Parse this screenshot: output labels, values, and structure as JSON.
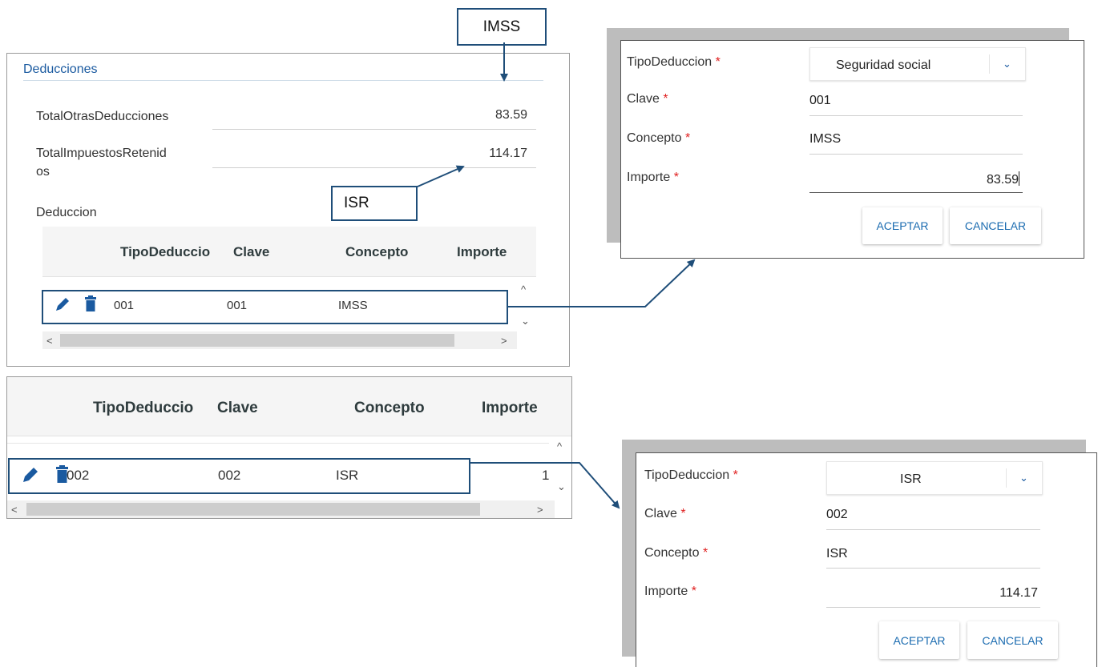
{
  "callouts": {
    "imss": "IMSS",
    "isr": "ISR"
  },
  "deducciones": {
    "title": "Deducciones",
    "total_otras_label": "TotalOtrasDeducciones",
    "total_otras_value": "83.59",
    "total_impuestos_label_line1": "TotalImpuestosRetenid",
    "total_impuestos_label_line2": "os",
    "total_impuestos_value": "114.17",
    "deduccion_label": "Deduccion"
  },
  "table_columns": [
    "TipoDeduccio",
    "Clave",
    "Concepto",
    "Importe"
  ],
  "table_top": {
    "row": {
      "tipo": "001",
      "clave": "001",
      "concepto": "IMSS"
    }
  },
  "table_bottom": {
    "row": {
      "tipo": "002",
      "clave": "002",
      "concepto": "ISR",
      "importe_partial": "1"
    }
  },
  "scroll_glyphs": {
    "up": "^",
    "down": "⌄",
    "left": "<",
    "right": ">"
  },
  "form_labels": {
    "tipo": "TipoDeduccion",
    "clave": "Clave",
    "concepto": "Concepto",
    "importe": "Importe",
    "required": "*"
  },
  "dialog_imss": {
    "tipo_value": "Seguridad social",
    "clave_value": "001",
    "concepto_value": "IMSS",
    "importe_value": "83.59",
    "accept": "ACEPTAR",
    "cancel": "CANCELAR"
  },
  "dialog_isr": {
    "tipo_value": "ISR",
    "clave_value": "002",
    "concepto_value": "ISR",
    "importe_value": "114.17",
    "accept": "ACEPTAR",
    "cancel": "CANCELAR"
  },
  "colors": {
    "callout_border": "#1f4e79",
    "title_blue": "#1a5aa0",
    "required_red": "#e02020",
    "button_text": "#1a6bb0",
    "icon_blue": "#1a5aa0"
  },
  "icons": [
    "pencil-icon",
    "trash-icon",
    "chevron-down-icon",
    "scroll-arrow-icon"
  ]
}
